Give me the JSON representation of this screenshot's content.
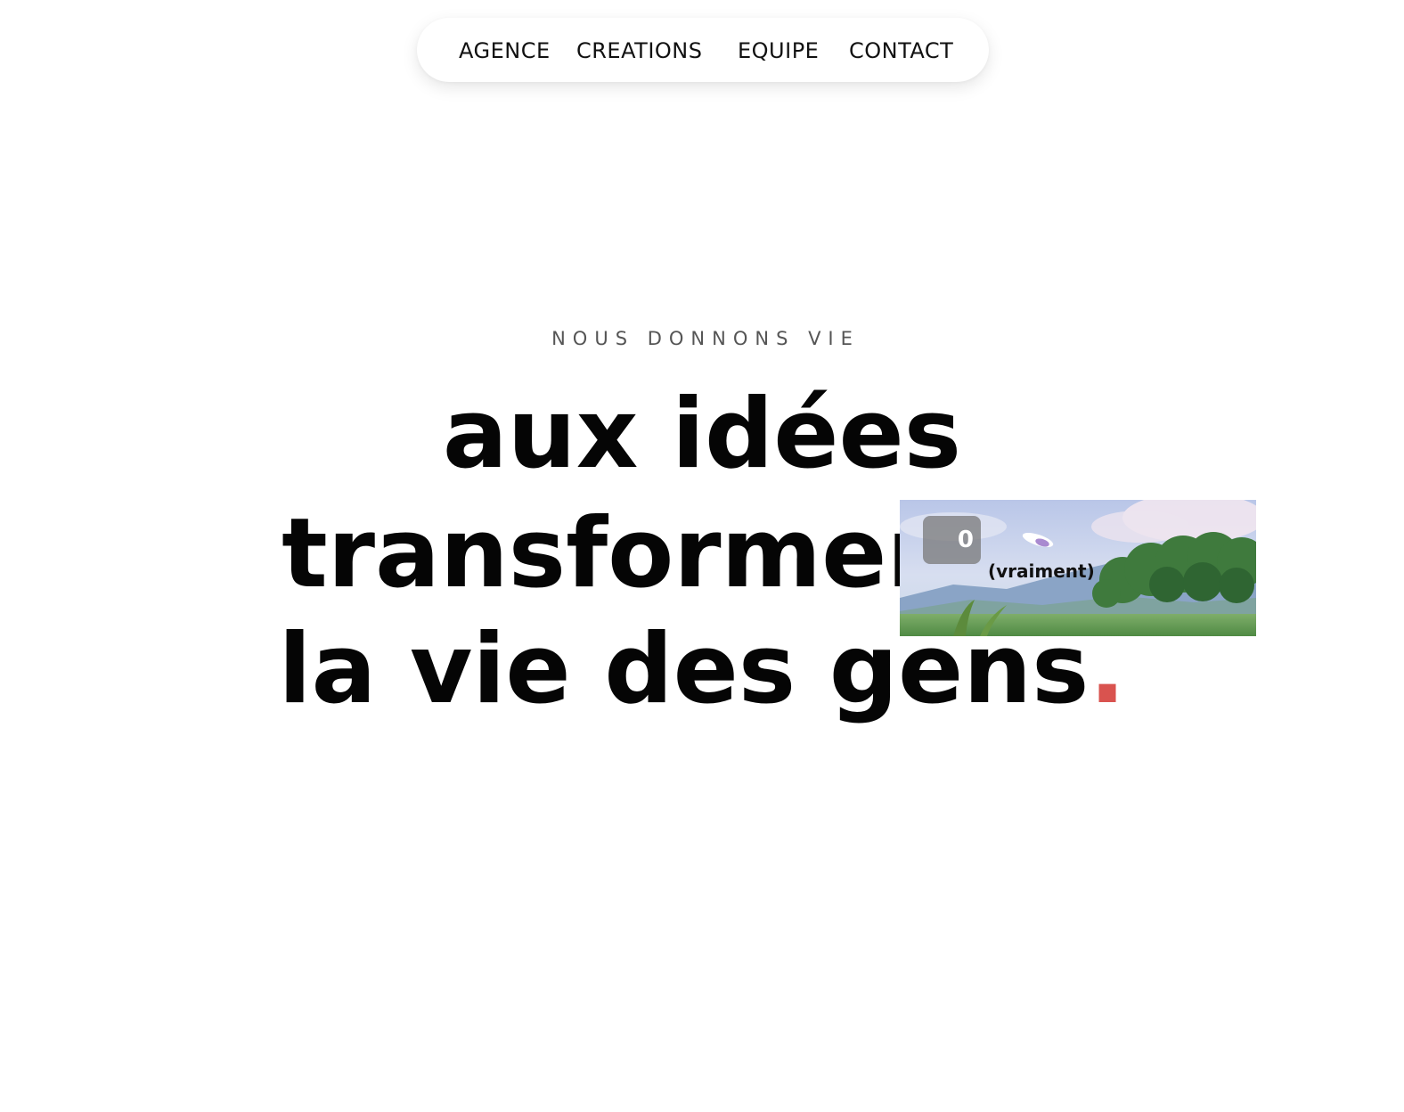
{
  "nav": {
    "items": [
      "AGENCE",
      "CREATIONS",
      "EQUIPE",
      "CONTACT"
    ]
  },
  "hero": {
    "eyebrow": "NOUS DONNONS VIE",
    "line1": "aux idées",
    "line2": "transforment",
    "line3": "la vie des gens",
    "line3_dot": ".",
    "accent_color": "#d9534f"
  },
  "video": {
    "counter": "0",
    "caption": "(vraiment)"
  }
}
